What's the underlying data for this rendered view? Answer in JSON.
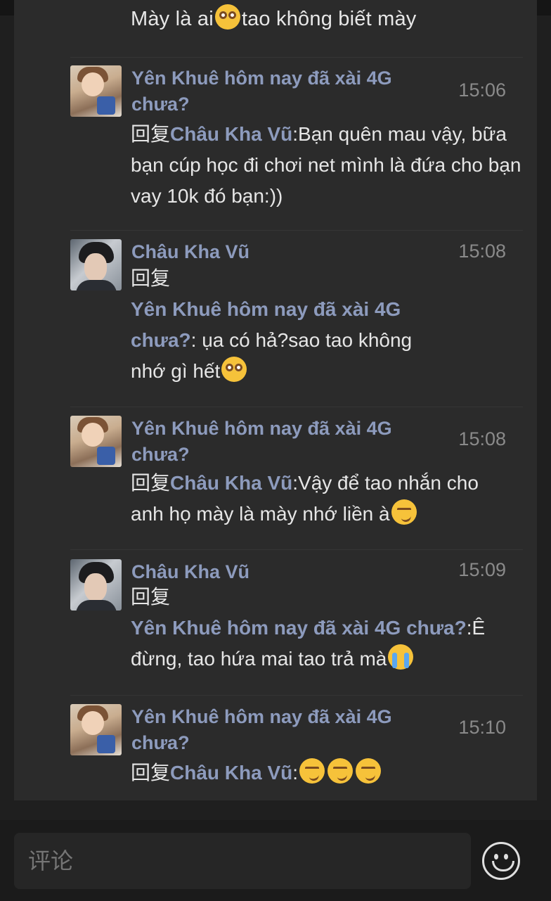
{
  "top_fragment": {
    "before": "Mày là ai",
    "after": "tao không biết mày"
  },
  "messages": [
    {
      "name": "Yên Khuê hôm nay đã xài 4G chưa?",
      "time": "15:06",
      "reply_prefix": "回复",
      "reply_target": "Châu Kha Vũ",
      "text": ":Bạn quên mau vậy, bữa bạn cúp học đi chơi net mình là đứa cho bạn vay 10k đó bạn:))"
    },
    {
      "name": "Châu Kha Vũ",
      "time": "15:08",
      "reply_prefix": "回复",
      "reply_target": "Yên Khuê hôm nay đã xài 4G chưa?",
      "text": ": ụa có hả?sao tao không nhớ gì hết"
    },
    {
      "name": "Yên Khuê hôm nay đã xài 4G chưa?",
      "time": "15:08",
      "reply_prefix": "回复",
      "reply_target": "Châu Kha Vũ",
      "text": ":Vậy để tao nhắn cho anh họ mày là mày nhớ liền à"
    },
    {
      "name": "Châu Kha Vũ",
      "time": "15:09",
      "reply_prefix": "回复",
      "reply_target": "Yên Khuê hôm nay đã xài 4G chưa?",
      "text": ":Ê đừng, tao hứa mai tao trả mà"
    },
    {
      "name": "Yên Khuê hôm nay đã xài 4G chưa?",
      "time": "15:10",
      "reply_prefix": "回复",
      "reply_target": "Châu Kha Vũ",
      "text": ":"
    }
  ],
  "comment_bar": {
    "placeholder": "评论",
    "emoji_icon": "smiley-face-icon"
  },
  "colors": {
    "background": "#1f1f1f",
    "panel": "#2b2b2b",
    "name": "#8d9bbd",
    "text": "#e6e6e6",
    "time": "#8a8a8a"
  }
}
